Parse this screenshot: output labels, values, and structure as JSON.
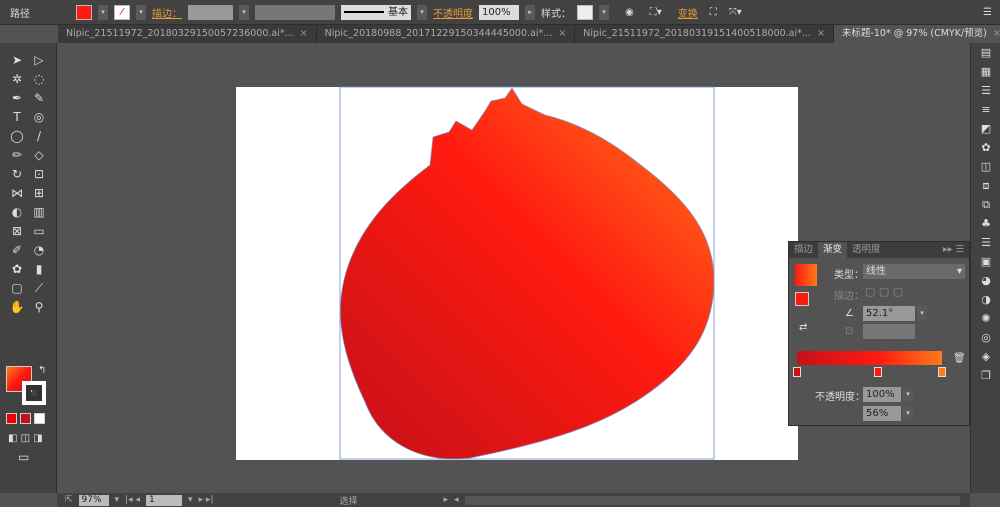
{
  "toolbar": {
    "selection_label": "路径",
    "fill_color": "#ff1a0f",
    "stroke_label": "描边：",
    "stroke_style": "基本",
    "opacity_label": "不透明度",
    "opacity_value": "100%",
    "style_label": "样式：",
    "transform_label": "变换"
  },
  "tabs": [
    {
      "label": "Nipic_21511972_20180329150057236000.ai*...",
      "active": false
    },
    {
      "label": "Nipic_20180988_20171229150344445000.ai*...",
      "active": false
    },
    {
      "label": "Nipic_21511972_20180319151400518000.ai*...",
      "active": false
    },
    {
      "label": "未标题-10* @ 97% (CMYK/预览)",
      "active": true
    }
  ],
  "tools": [
    "selection-icon",
    "direct-selection-icon",
    "magic-wand-icon",
    "lasso-icon",
    "pen-icon",
    "curvature-icon",
    "type-icon",
    "spiral-icon",
    "ellipse-icon",
    "brush-icon",
    "pencil-icon",
    "eraser-icon",
    "rotate-icon",
    "scale-icon",
    "width-icon",
    "free-transform-icon",
    "shape-builder-icon",
    "chart-icon",
    "mesh-icon",
    "gradient-icon",
    "eyedropper-icon",
    "blend-icon",
    "symbol-sprayer-icon",
    "column-graph-icon",
    "artboard-icon",
    "slice-icon",
    "hand-icon",
    "zoom-icon"
  ],
  "tool_glyphs": [
    "➤",
    "▷",
    "✲",
    "◌",
    "✒",
    "✎",
    "T",
    "◎",
    "◯",
    "∕",
    "✏",
    "◇",
    "↻",
    "⊡",
    "⋈",
    "⊞",
    "◐",
    "▥",
    "⊠",
    "▭",
    "✐",
    "◔",
    "✿",
    "▮",
    "▢",
    "⟋",
    "✋",
    "⚲"
  ],
  "dock": [
    "color-icon",
    "color-guide-icon",
    "layers-list-icon",
    "align-icon",
    "transform-icon",
    "pathfinder-icon",
    "brushes-icon",
    "symbols-icon",
    "graphic-styles-icon",
    "artboards-icon",
    "links-icon",
    "appearance-icon",
    "stroke-icon",
    "gradient-icon",
    "transparency-icon",
    "sun-icon",
    "layers-icon",
    "artboards-stack-icon"
  ],
  "dock_glyphs": [
    "▤",
    "▦",
    "☰",
    "≡",
    "◩",
    "✿",
    "◫",
    "⧈",
    "⧉",
    "♣",
    "☰",
    "▣",
    "◕",
    "◑",
    "✺",
    "◎",
    "◈",
    "❐"
  ],
  "gradient_panel": {
    "tabs": [
      "描边",
      "渐变",
      "透明度"
    ],
    "type_label": "类型：",
    "type_value": "线性",
    "stroke_label": "描边：",
    "angle_value": "52.1°",
    "opacity_label": "不透明度：",
    "opacity_value": "100%",
    "location_value": "56%",
    "stops": [
      "#c8101a",
      "#ff1a0f",
      "#ff7a1a"
    ]
  },
  "artwork": {
    "gradient_start": "#c41019",
    "gradient_mid": "#ff1a0f",
    "gradient_end": "#ff7a1a"
  },
  "status": {
    "zoom": "97%",
    "page": "1",
    "mode": "选择"
  }
}
